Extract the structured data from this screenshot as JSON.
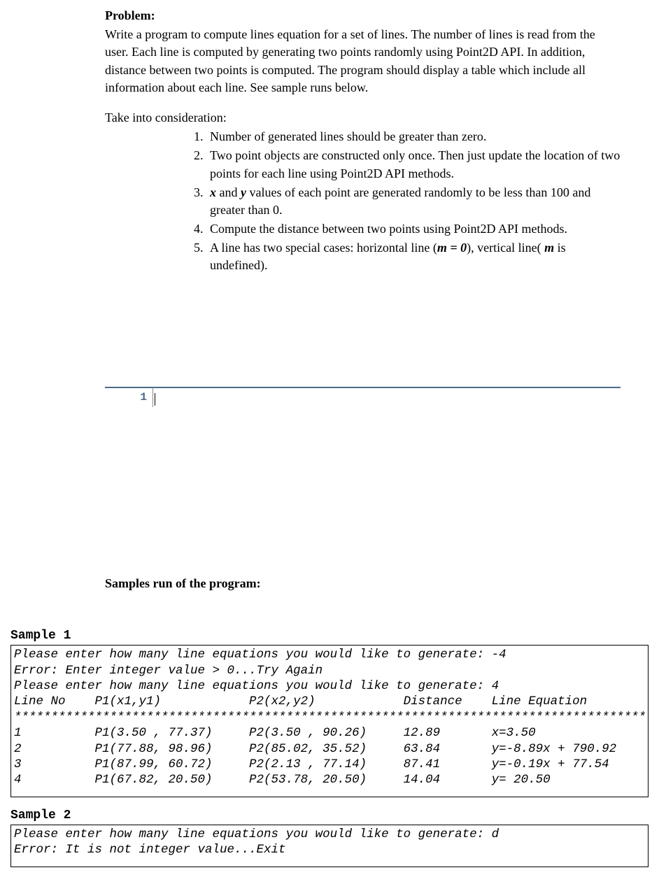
{
  "problem": {
    "heading": "Problem:",
    "body": "Write a program to compute lines equation for a set of lines. The number of lines is read from the user. Each line is computed by generating two points randomly using Point2D API. In addition, distance between two points is computed. The program should display a table which include all information about each line. See sample runs below.",
    "consideration_label": "Take into consideration:",
    "considerations": {
      "item1": "Number of generated lines should be greater than zero.",
      "item2": "Two point objects are constructed only once. Then just update the location of two points for each line using Point2D API methods.",
      "item3_prefix_var1": "x",
      "item3_mid1": " and ",
      "item3_var2": "y",
      "item3_rest": " values of each point are generated randomly to be less than 100 and greater than 0.",
      "item4": "Compute the distance between two points using Point2D API methods.",
      "item5_prefix": "A line has two special cases: horizontal line (",
      "item5_eq": "m = 0",
      "item5_mid": "), vertical line( ",
      "item5_var": "m",
      "item5_suffix": " is undefined)."
    }
  },
  "editor": {
    "line_number": "1"
  },
  "samples": {
    "heading": "Samples run of the program:",
    "sample1_label": "Sample 1",
    "sample1_content": "Please enter how many line equations you would like to generate: -4\nError: Enter integer value > 0...Try Again\nPlease enter how many line equations you would like to generate: 4\nLine No    P1(x1,y1)            P2(x2,y2)            Distance    Line Equation\n*****************************************************************************************\n1          P1(3.50 , 77.37)     P2(3.50 , 90.26)     12.89       x=3.50\n2          P1(77.88, 98.96)     P2(85.02, 35.52)     63.84       y=-8.89x + 790.92\n3          P1(87.99, 60.72)     P2(2.13 , 77.14)     87.41       y=-0.19x + 77.54\n4          P1(67.82, 20.50)     P2(53.78, 20.50)     14.04       y= 20.50",
    "sample2_label": "Sample 2",
    "sample2_content": "Please enter how many line equations you would like to generate: d\nError: It is not integer value...Exit"
  }
}
